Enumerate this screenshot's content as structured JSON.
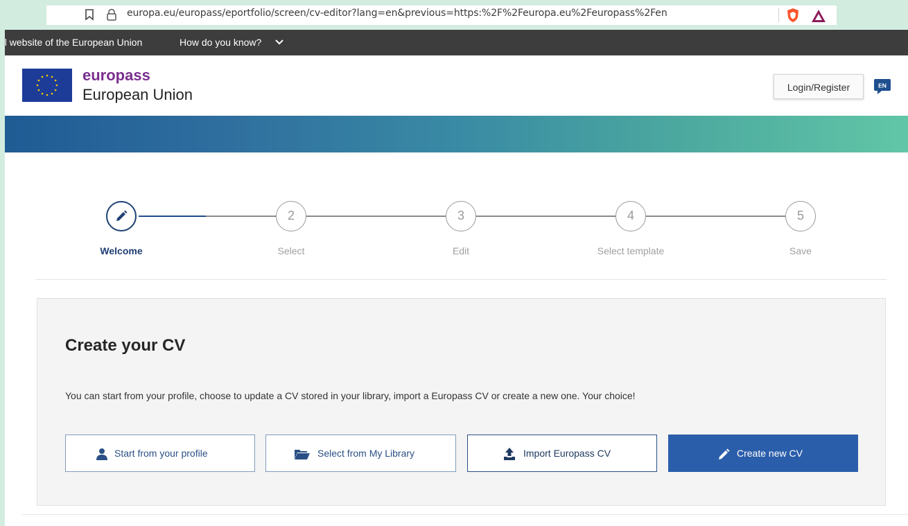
{
  "browser": {
    "url": "europa.eu/europass/eportfolio/screen/cv-editor?lang=en&previous=https:%2F%2Feuropa.eu%2Feuropass%2Fen"
  },
  "eu_banner": {
    "text": "al website of the European Union",
    "link": "How do you know?"
  },
  "header": {
    "brand": "europass",
    "brand_sub": "European Union",
    "login_label": "Login/Register",
    "language": "EN"
  },
  "stepper": {
    "steps": [
      {
        "number": "",
        "label": "Welcome"
      },
      {
        "number": "2",
        "label": "Select"
      },
      {
        "number": "3",
        "label": "Edit"
      },
      {
        "number": "4",
        "label": "Select template"
      },
      {
        "number": "5",
        "label": "Save"
      }
    ]
  },
  "main": {
    "title": "Create your CV",
    "description": "You can start from your profile, choose to update a CV stored in your library, import a Europass CV or create a new one. Your choice!",
    "buttons": [
      {
        "label": "Start from your profile",
        "icon": "user-icon"
      },
      {
        "label": "Select from My Library",
        "icon": "folder-open-icon"
      },
      {
        "label": "Import Europass CV",
        "icon": "upload-icon"
      },
      {
        "label": "Create new CV",
        "icon": "pencil-icon"
      }
    ]
  },
  "colors": {
    "brand_purple": "#7a2f8e",
    "primary_blue": "#2b5eaa",
    "eu_blue": "#1d3c97",
    "eu_gold": "#ffcc00"
  }
}
